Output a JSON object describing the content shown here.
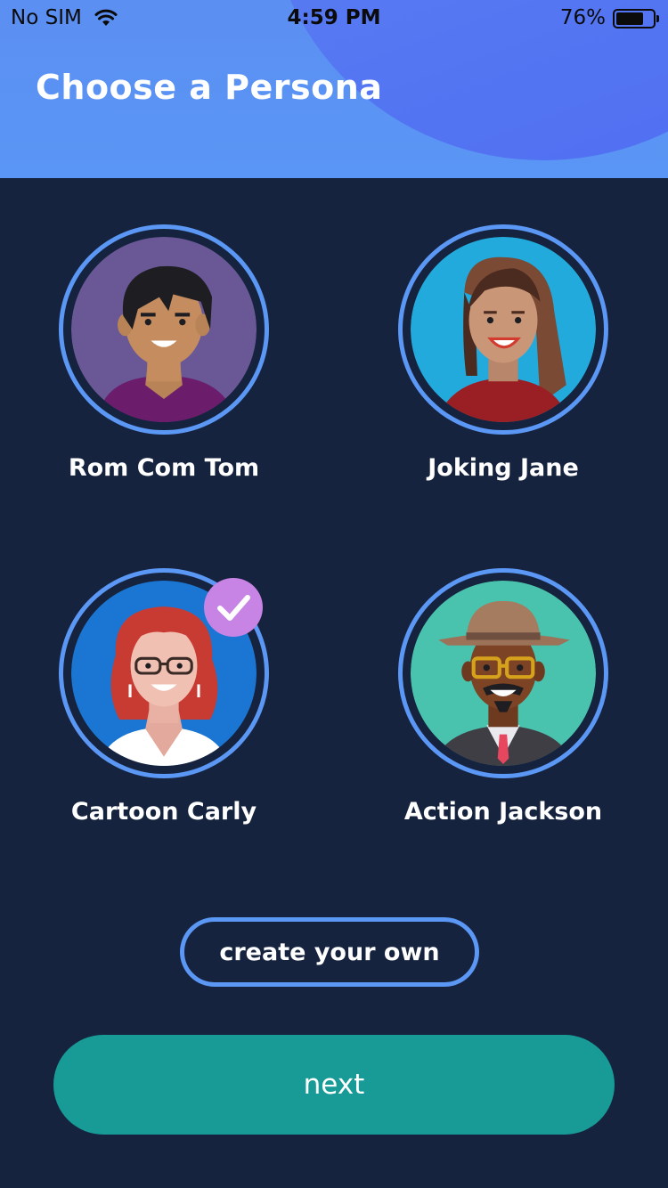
{
  "status_bar": {
    "carrier": "No SIM",
    "time": "4:59 PM",
    "battery_percent": "76%",
    "battery_level": 0.76,
    "wifi_icon": "wifi-icon"
  },
  "header": {
    "title": "Choose a Persona"
  },
  "personas": [
    {
      "name": "Rom Com Tom",
      "selected": false,
      "avatar_icon": "avatar-tom"
    },
    {
      "name": "Joking Jane",
      "selected": false,
      "avatar_icon": "avatar-jane"
    },
    {
      "name": "Cartoon Carly",
      "selected": true,
      "avatar_icon": "avatar-carly"
    },
    {
      "name": "Action Jackson",
      "selected": false,
      "avatar_icon": "avatar-jackson"
    }
  ],
  "actions": {
    "create_label": "create your own",
    "next_label": "next"
  },
  "colors": {
    "background": "#16233e",
    "header": "#5b8ff2",
    "ring": "#5b97f4",
    "next_button": "#189a96",
    "check_badge": "#c784e4"
  }
}
